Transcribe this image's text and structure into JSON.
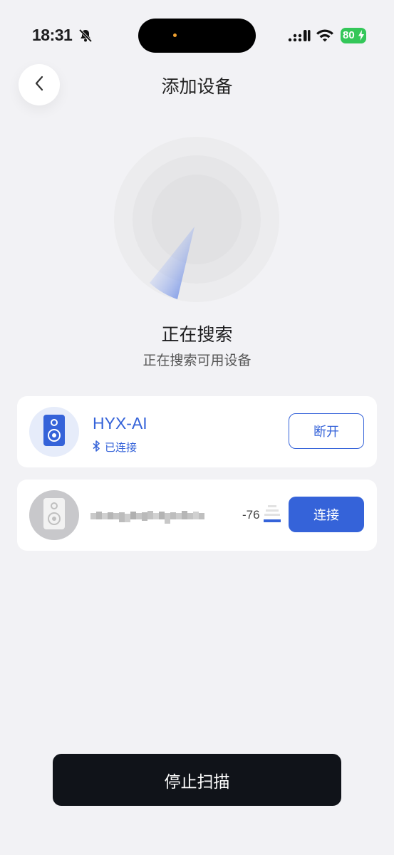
{
  "status_bar": {
    "time": "18:31",
    "battery": "80",
    "icons": [
      "bell-muted-icon",
      "cellular-signal-icon",
      "wifi-icon",
      "battery-charging-icon"
    ]
  },
  "header": {
    "title": "添加设备",
    "back_icon": "chevron-left-icon"
  },
  "scan": {
    "title": "正在搜索",
    "subtitle": "正在搜索可用设备"
  },
  "devices": [
    {
      "name": "HYX-AI",
      "status": "已连接",
      "status_icon": "bluetooth-icon",
      "icon": "speaker-icon",
      "action": "断开",
      "accent": "#3563d9"
    },
    {
      "name": "",
      "rssi": "-76",
      "icon": "speaker-icon",
      "action": "连接",
      "signal_level": 0.25
    }
  ],
  "footer": {
    "stop_label": "停止扫描"
  },
  "colors": {
    "accent": "#3563d9",
    "stop_button": "#101319",
    "background": "#f2f2f5",
    "battery": "#34c759"
  }
}
